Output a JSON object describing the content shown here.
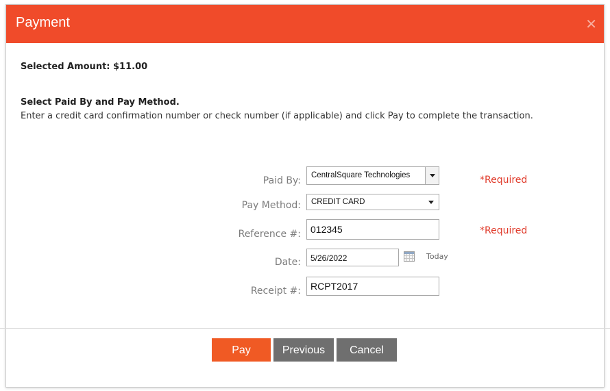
{
  "dialog": {
    "title": "Payment",
    "close_icon": "close-icon",
    "accent_color": "#f04b2a"
  },
  "summary": {
    "selected_amount": "Selected Amount:  $11.00"
  },
  "instructions": {
    "heading": "Select Paid By and Pay Method.",
    "body": "Enter a credit card confirmation number or check number (if applicable) and click Pay to complete the transaction."
  },
  "form": {
    "paid_by": {
      "label": "Paid By:",
      "value": "CentralSquare Technologies",
      "required_text": "*Required"
    },
    "pay_method": {
      "label": "Pay Method:",
      "value": "CREDIT CARD"
    },
    "reference": {
      "label": "Reference #:",
      "value": "012345",
      "required_text": "*Required"
    },
    "date": {
      "label": "Date:",
      "value": "5/26/2022",
      "calendar_icon": "calendar-icon",
      "today_label": "Today"
    },
    "receipt": {
      "label": "Receipt #:",
      "value": "RCPT2017"
    }
  },
  "buttons": {
    "pay": "Pay",
    "previous": "Previous",
    "cancel": "Cancel"
  }
}
